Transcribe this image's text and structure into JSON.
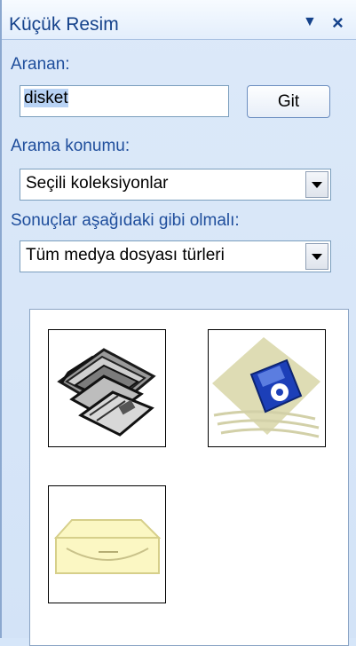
{
  "pane": {
    "title": "Küçük Resim",
    "menu_arrow": "▼",
    "close": "×"
  },
  "search": {
    "label": "Aranan:",
    "value": "disket",
    "go_label": "Git"
  },
  "location": {
    "label": "Arama konumu:",
    "selected": "Seçili koleksiyonlar"
  },
  "results_type": {
    "label": "Sonuçlar aşağıdaki gibi olmalı:",
    "selected": "Tüm medya dosyası türleri"
  },
  "results": {
    "items": [
      {
        "icon": "floppy-disks-clipart-icon"
      },
      {
        "icon": "blue-floppy-clipart-icon"
      },
      {
        "icon": "disk-drive-clipart-icon"
      }
    ]
  },
  "colors": {
    "pane_bg": "#d6e6f9",
    "title_text": "#15428b",
    "label_text": "#1f4e9c",
    "floppy_blue": "#1c3fb8",
    "drive_yellow": "#fbf7c3"
  }
}
